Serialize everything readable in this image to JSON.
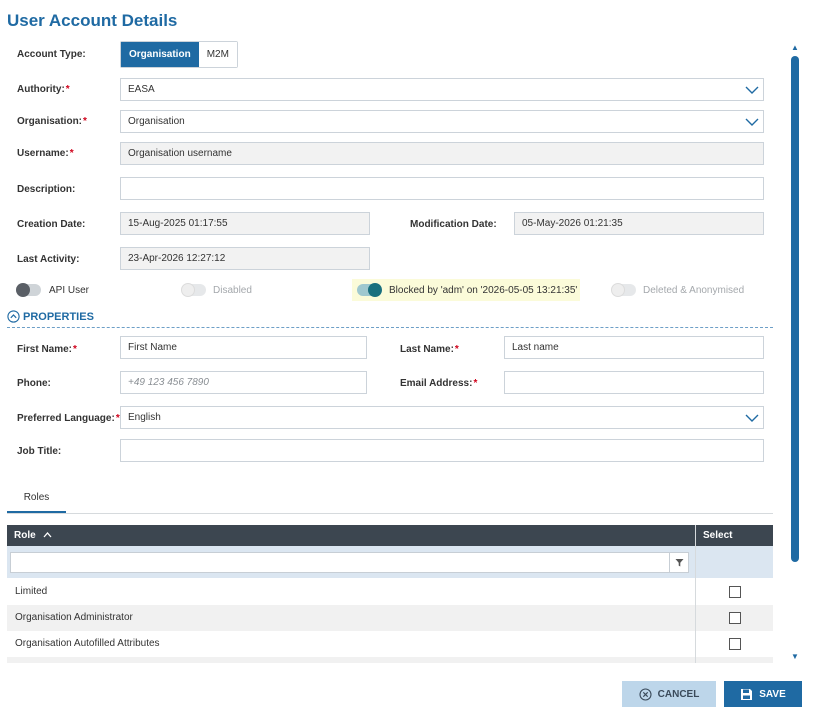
{
  "page": {
    "title": "User Account Details"
  },
  "account_type": {
    "label": "Account Type:",
    "options": [
      "Organisation",
      "M2M"
    ],
    "selected": "Organisation"
  },
  "authority": {
    "label": "Authority:",
    "required": "*",
    "value": "EASA"
  },
  "organisation": {
    "label": "Organisation:",
    "required": "*",
    "value": "Organisation"
  },
  "username": {
    "label": "Username:",
    "required": "*",
    "value": "Organisation username"
  },
  "description": {
    "label": "Description:",
    "value": ""
  },
  "creation_date": {
    "label": "Creation Date:",
    "value": "15-Aug-2025 01:17:55"
  },
  "modification_date": {
    "label": "Modification Date:",
    "value": "05-May-2026 01:21:35"
  },
  "last_activity": {
    "label": "Last Activity:",
    "value": "23-Apr-2026 12:27:12"
  },
  "toggles": {
    "api_user": {
      "label": "API User",
      "state": "off"
    },
    "disabled": {
      "label": "Disabled",
      "state": "off-disabled"
    },
    "blocked": {
      "label": "Blocked by 'adm' on '2026-05-05 13:21:35'",
      "state": "on"
    },
    "deleted": {
      "label": "Deleted & Anonymised",
      "state": "off-disabled"
    }
  },
  "properties": {
    "section_title": "PROPERTIES",
    "first_name": {
      "label": "First Name:",
      "required": "*",
      "value": "First Name"
    },
    "last_name": {
      "label": "Last Name:",
      "required": "*",
      "value": "Last name"
    },
    "phone": {
      "label": "Phone:",
      "placeholder": "+49 123 456 7890"
    },
    "email": {
      "label": "Email Address:",
      "required": "*",
      "value": ""
    },
    "preferred_language": {
      "label": "Preferred Language:",
      "required": "*",
      "value": "English"
    },
    "job_title": {
      "label": "Job Title:",
      "value": ""
    }
  },
  "roles": {
    "tab_label": "Roles",
    "columns": {
      "role": "Role",
      "role_sort_icon": "chevron-up-icon",
      "select": "Select"
    },
    "filter_icon": "filter-icon",
    "rows": [
      {
        "role": "Limited",
        "selected": false
      },
      {
        "role": "Organisation Administrator",
        "selected": false
      },
      {
        "role": "Organisation Autofilled Attributes",
        "selected": false
      }
    ]
  },
  "buttons": {
    "cancel": "CANCEL",
    "save": "SAVE"
  },
  "colors": {
    "accent": "#1f6aa3",
    "toggle_on": "#19707e",
    "highlight": "#fbfbd9",
    "header": "#3c4650"
  }
}
